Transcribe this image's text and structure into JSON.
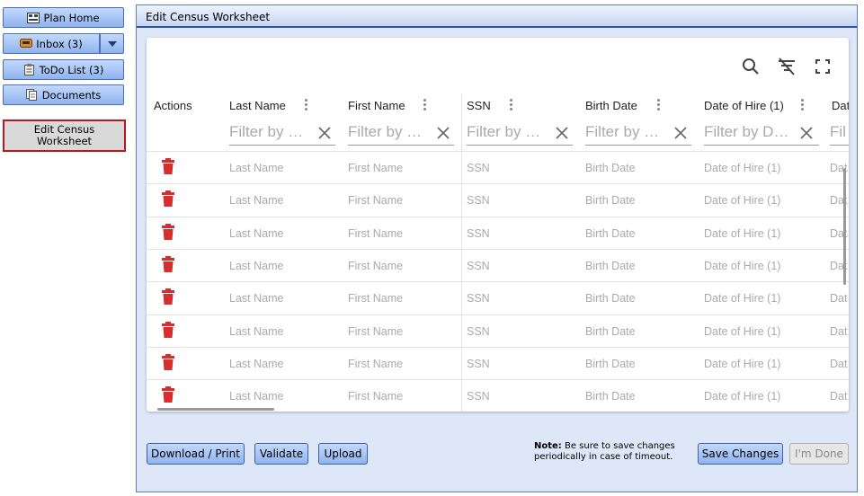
{
  "nav": {
    "plan_home": "Plan Home",
    "inbox": "Inbox (3)",
    "todo": "ToDo List (3)",
    "documents": "Documents",
    "edit_census": "Edit Census Worksheet"
  },
  "panel": {
    "title": "Edit Census Worksheet"
  },
  "grid": {
    "actions_header": "Actions",
    "columns": [
      {
        "label": "Last Name",
        "filter": "Filter by …"
      },
      {
        "label": "First Name",
        "filter": "Filter by …"
      },
      {
        "label": "SSN",
        "filter": "Filter by …"
      },
      {
        "label": "Birth Date",
        "filter": "Filter by …"
      },
      {
        "label": "Date of Hire (1)",
        "filter": "Filter by D…"
      },
      {
        "label": "Dat",
        "filter": "Fil"
      }
    ],
    "rows": [
      [
        "Last Name",
        "First Name",
        "SSN",
        "Birth Date",
        "Date of Hire (1)",
        "Dat"
      ],
      [
        "Last Name",
        "First Name",
        "SSN",
        "Birth Date",
        "Date of Hire (1)",
        "Dat"
      ],
      [
        "Last Name",
        "First Name",
        "SSN",
        "Birth Date",
        "Date of Hire (1)",
        "Dat"
      ],
      [
        "Last Name",
        "First Name",
        "SSN",
        "Birth Date",
        "Date of Hire (1)",
        "Dat"
      ],
      [
        "Last Name",
        "First Name",
        "SSN",
        "Birth Date",
        "Date of Hire (1)",
        "Dat"
      ],
      [
        "Last Name",
        "First Name",
        "SSN",
        "Birth Date",
        "Date of Hire (1)",
        "Dat"
      ],
      [
        "Last Name",
        "First Name",
        "SSN",
        "Birth Date",
        "Date of Hire (1)",
        "Dat"
      ],
      [
        "Last Name",
        "First Name",
        "SSN",
        "Birth Date",
        "Date of Hire (1)",
        "Dat"
      ]
    ]
  },
  "footer": {
    "download": "Download / Print",
    "validate": "Validate",
    "upload": "Upload",
    "note_label": "Note:",
    "note_text": " Be sure to save changes periodically in case of timeout.",
    "save": "Save Changes",
    "done": "I'm Done"
  },
  "colors": {
    "button_top": "#c3d9fb",
    "button_bottom": "#8fb3ee",
    "active_border": "#c0161b",
    "trash": "#d32f2f"
  },
  "icons": [
    "search-icon",
    "clear-filter-icon",
    "fullscreen-icon",
    "trash-icon",
    "close-icon",
    "more-vert-icon"
  ]
}
